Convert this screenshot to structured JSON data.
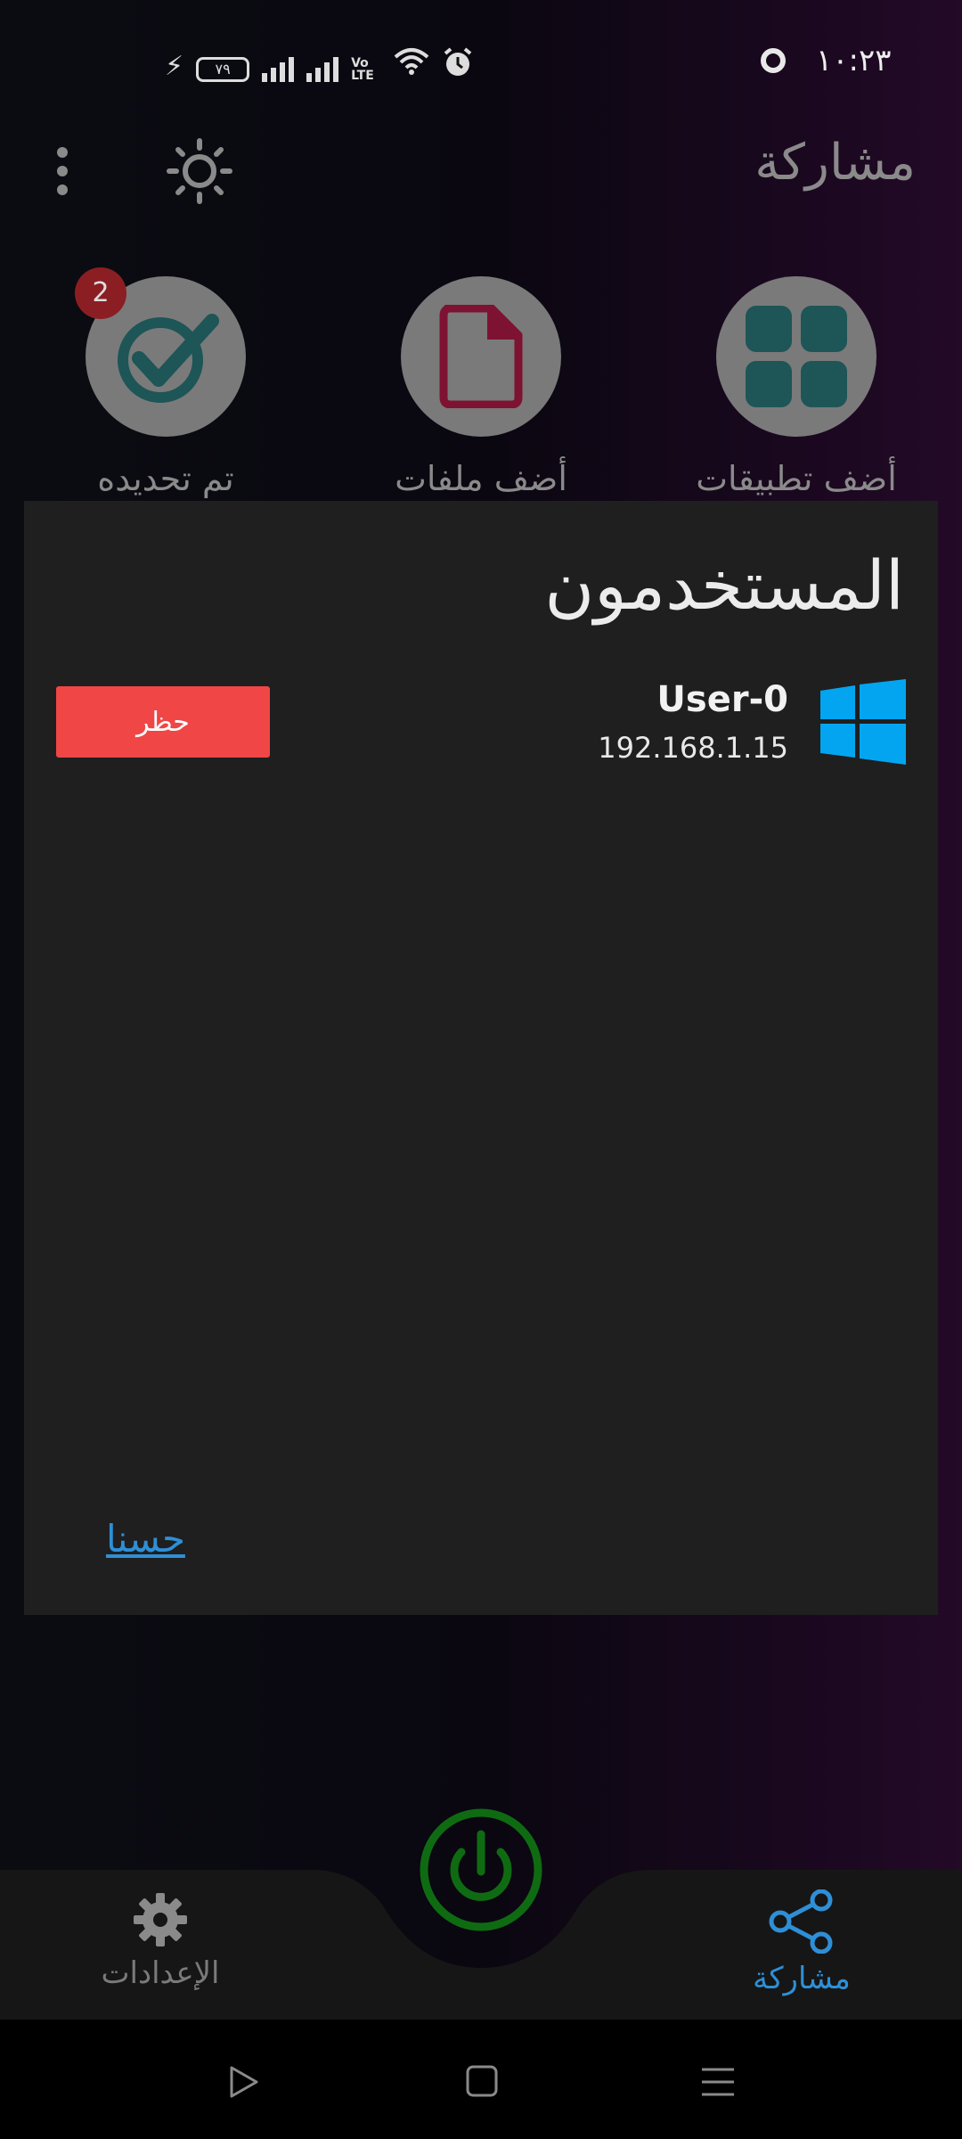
{
  "status_bar": {
    "time": "١٠:٢٣",
    "battery_level": "٧٩",
    "volte_text": "Vo LTE",
    "icons": [
      "sync-ring-icon",
      "charging-bolt-icon",
      "battery-icon",
      "signal-icon",
      "signal-icon",
      "volte-icon",
      "wifi-icon",
      "alarm-icon"
    ]
  },
  "header": {
    "title": "مشاركة"
  },
  "actions": [
    {
      "label": "أضف تطبيقات",
      "icon": "apps-grid-icon"
    },
    {
      "label": "أضف ملفات",
      "icon": "file-icon"
    },
    {
      "label": "تم تحديده",
      "icon": "check-circle-icon",
      "badge": "2"
    }
  ],
  "dialog": {
    "title": "المستخدمون",
    "user": {
      "name": "User-0",
      "ip": "192.168.1.15",
      "icon": "windows-logo-icon"
    },
    "block_label": "حظر",
    "ok_label": "حسنا"
  },
  "bottom_nav": {
    "settings_label": "الإعدادات",
    "share_label": "مشاركة",
    "active": "share"
  },
  "colors": {
    "accent_blue": "#2e8fd6",
    "block_red": "#f14646",
    "power_green": "#0f6b12",
    "windows_blue": "#04a5f0",
    "icon_teal": "#1e5557",
    "file_red": "#7e1232"
  }
}
